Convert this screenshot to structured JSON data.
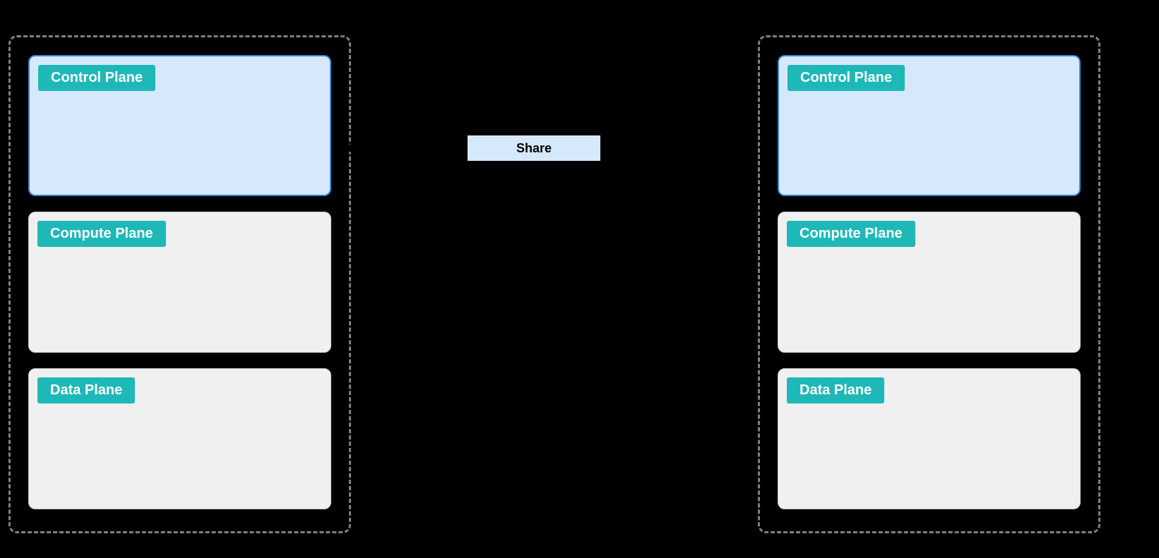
{
  "left": {
    "planes": [
      {
        "label": "Control Plane",
        "type": "control"
      },
      {
        "label": "Compute Plane",
        "type": "compute"
      },
      {
        "label": "Data Plane",
        "type": "data"
      }
    ]
  },
  "right": {
    "planes": [
      {
        "label": "Control Plane",
        "type": "control"
      },
      {
        "label": "Compute Plane",
        "type": "compute"
      },
      {
        "label": "Data Plane",
        "type": "data"
      }
    ]
  },
  "center": {
    "share_label": "Share"
  }
}
